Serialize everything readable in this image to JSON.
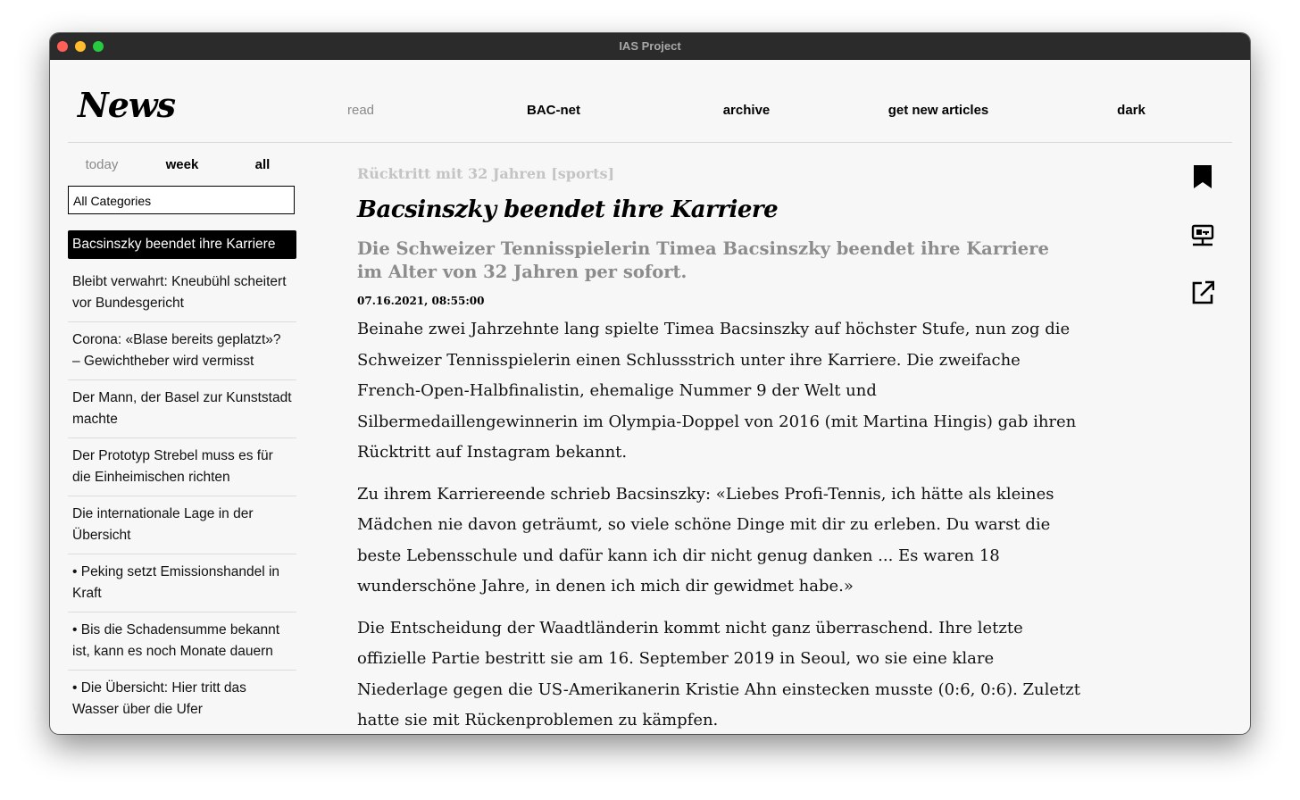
{
  "window": {
    "title": "IAS Project"
  },
  "header": {
    "logo": "News",
    "nav": [
      "read",
      "BAC-net",
      "archive",
      "get new articles",
      "dark"
    ]
  },
  "sidebar": {
    "filters": [
      "today",
      "week",
      "all"
    ],
    "category": "All Categories",
    "articles": [
      "Bacsinszky beendet ihre Karriere",
      "Bleibt verwahrt: Kneubühl scheitert vor Bundesgericht",
      "Corona: «Blase bereits geplatzt»? – Gewichtheber wird vermisst",
      "Der Mann, der Basel zur Kunststadt machte",
      "Der Prototyp Strebel muss es für die Einheimischen richten",
      "Die internationale Lage in der Übersicht",
      "• Peking setzt Emissionshandel in Kraft",
      "• Bis die Schadensumme bekannt ist, kann es noch Monate dauern",
      "• Die Übersicht: Hier tritt das Wasser über die Ufer"
    ]
  },
  "article": {
    "kicker": "Rücktritt mit 32 Jahren [sports]",
    "headline": "Bacsinszky beendet ihre Karriere",
    "lead": "Die Schweizer Tennisspielerin Timea Bacsinszky beendet ihre Karriere im Alter von 32 Jahren per sofort.",
    "date": "07.16.2021, 08:55:00",
    "paragraphs": [
      "Beinahe zwei Jahrzehnte lang spielte Timea Bacsinszky auf höchster Stufe, nun zog die Schweizer Tennisspielerin einen Schlussstrich unter ihre Karriere. Die zweifache French-Open-Halbfinalistin, ehemalige Nummer 9 der Welt und Silbermedaillengewinnerin im Olympia-Doppel von 2016 (mit Martina Hingis) gab ihren Rücktritt auf Instagram bekannt.",
      "Zu ihrem Karriereende schrieb Bacsinszky: «Liebes Profi-Tennis, ich hätte als kleines Mädchen nie davon geträumt, so viele schöne Dinge mit dir zu erleben. Du warst die beste Lebensschule und dafür kann ich dir nicht genug danken ... Es waren 18 wunderschöne Jahre, in denen ich mich dir gewidmet habe.»",
      "Die Entscheidung der Waadtländerin kommt nicht ganz überraschend. Ihre letzte offizielle Partie bestritt sie am 16. September 2019 in Seoul, wo sie eine klare Niederlage gegen die US-Amerikanerin Kristie Ahn einstecken musste (0:6, 0:6). Zuletzt hatte sie mit Rückenproblemen zu kämpfen."
    ]
  },
  "icons": [
    "bookmark-icon",
    "network-share-icon",
    "external-link-icon"
  ]
}
